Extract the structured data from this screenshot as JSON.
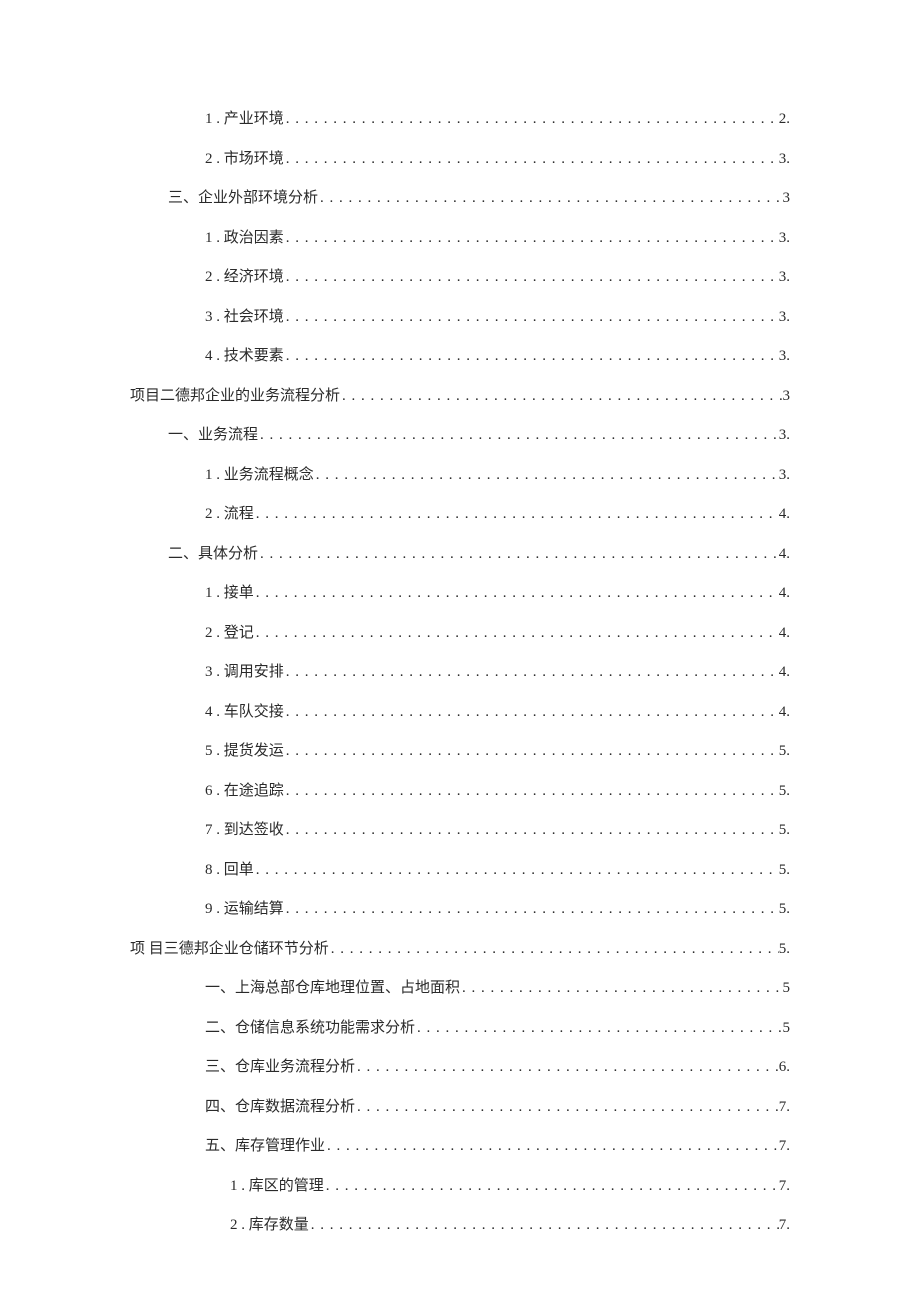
{
  "toc": [
    {
      "indent": 2,
      "label": "1 . 产业环境",
      "page": "2."
    },
    {
      "indent": 2,
      "label": "2 . 市场环境",
      "page": "3."
    },
    {
      "indent": 1,
      "label": "三、企业外部环境分析",
      "page": "3"
    },
    {
      "indent": 2,
      "label": "1 . 政治因素",
      "page": "3."
    },
    {
      "indent": 2,
      "label": "2 . 经济环境",
      "page": "3."
    },
    {
      "indent": 2,
      "label": "3 . 社会环境",
      "page": "3."
    },
    {
      "indent": 2,
      "label": "4 . 技术要素",
      "page": "3."
    },
    {
      "indent": 0,
      "label": "项目二德邦企业的业务流程分析",
      "page": "3"
    },
    {
      "indent": 1,
      "label": "一、业务流程",
      "page": "3."
    },
    {
      "indent": 2,
      "label": "1 . 业务流程概念",
      "page": "3."
    },
    {
      "indent": 2,
      "label": "2 . 流程",
      "page": "4."
    },
    {
      "indent": 1,
      "label": "二、具体分析",
      "page": "4."
    },
    {
      "indent": 2,
      "label": "1 . 接单",
      "page": "4."
    },
    {
      "indent": 2,
      "label": "2 . 登记",
      "page": "4."
    },
    {
      "indent": 2,
      "label": "3 . 调用安排",
      "page": "4."
    },
    {
      "indent": 2,
      "label": "4 . 车队交接",
      "page": "4."
    },
    {
      "indent": 2,
      "label": "5 . 提货发运",
      "page": "5."
    },
    {
      "indent": 2,
      "label": "6 . 在途追踪",
      "page": "5."
    },
    {
      "indent": 2,
      "label": "7 . 到达签收",
      "page": "5."
    },
    {
      "indent": 2,
      "label": "8 . 回单",
      "page": "5."
    },
    {
      "indent": 2,
      "label": "9 . 运输结算",
      "page": "5."
    },
    {
      "indent": 0,
      "label": "项 目三德邦企业仓储环节分析",
      "page": "5."
    },
    {
      "indent": 2,
      "label": "一、上海总部仓库地理位置、占地面积",
      "page": "5"
    },
    {
      "indent": 2,
      "label": "二、仓储信息系统功能需求分析",
      "page": "5"
    },
    {
      "indent": 2,
      "label": "三、仓库业务流程分析",
      "page": "6."
    },
    {
      "indent": 2,
      "label": "四、仓库数据流程分析",
      "page": "7."
    },
    {
      "indent": 2,
      "label": "五、库存管理作业",
      "page": "7."
    },
    {
      "indent": 3,
      "label": "1 . 库区的管理",
      "page": "7."
    },
    {
      "indent": 3,
      "label": "2 . 库存数量",
      "page": "7."
    }
  ]
}
